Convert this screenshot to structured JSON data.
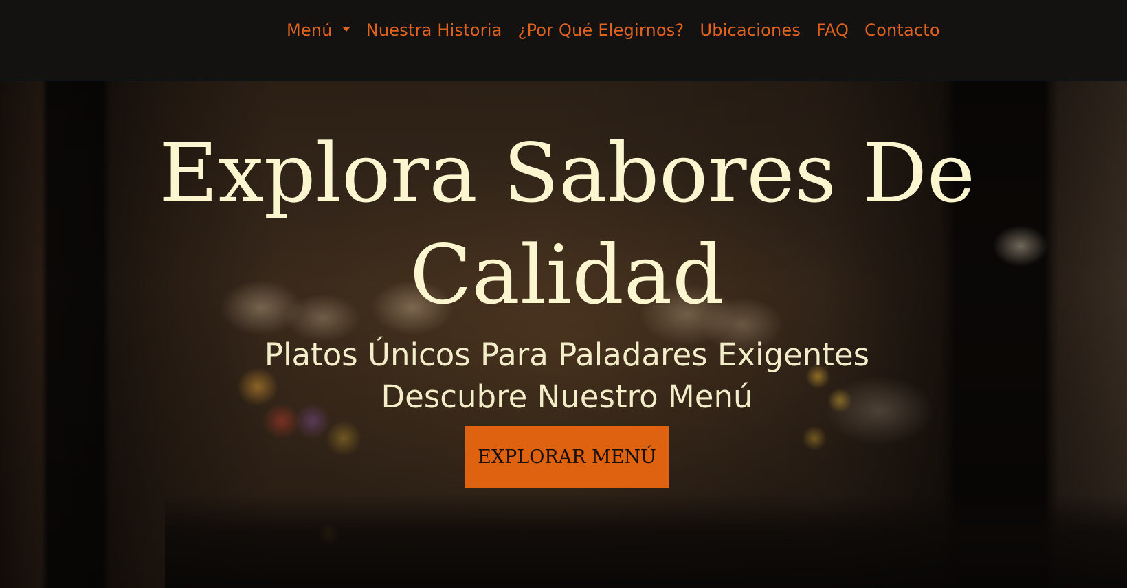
{
  "nav": {
    "items": [
      {
        "label": "Menú",
        "has_dropdown": true
      },
      {
        "label": "Nuestra Historia"
      },
      {
        "label": "¿Por Qué Elegirnos?"
      },
      {
        "label": "Ubicaciones"
      },
      {
        "label": "FAQ"
      },
      {
        "label": "Contacto"
      }
    ],
    "dropdown_icon": "caret-down-icon"
  },
  "hero": {
    "title_line1": "Explora Sabores De",
    "title_line2": "Calidad",
    "subtitle_line1": "Platos Únicos Para Paladares Exigentes",
    "subtitle_line2": "Descubre Nuestro Menú",
    "cta_label": "EXPLORAR MENÚ"
  },
  "colors": {
    "background": "#141111",
    "accent": "#de6210",
    "nav_link": "#e0621f",
    "hero_text": "#fbf6cf"
  }
}
